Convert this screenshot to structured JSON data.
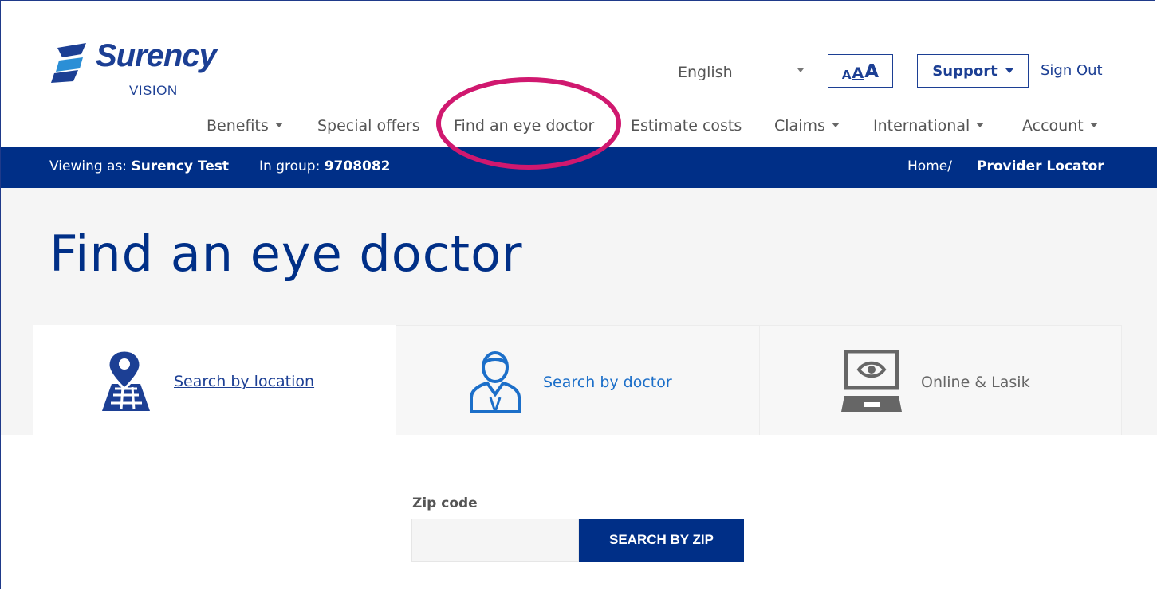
{
  "brand": {
    "name": "Surency",
    "sub": "VISION"
  },
  "header": {
    "language": "English",
    "text_size": {
      "small": "A",
      "medium": "A",
      "large": "A"
    },
    "support_label": "Support",
    "signout_label": "Sign Out"
  },
  "nav": {
    "items": [
      {
        "label": "Benefits",
        "dropdown": true
      },
      {
        "label": "Special offers",
        "dropdown": false
      },
      {
        "label": "Find an eye doctor",
        "dropdown": false
      },
      {
        "label": "Estimate costs",
        "dropdown": false
      },
      {
        "label": "Claims",
        "dropdown": true
      },
      {
        "label": "International",
        "dropdown": true
      },
      {
        "label": "Account",
        "dropdown": true
      }
    ]
  },
  "bar": {
    "viewing_prefix": "Viewing as:",
    "viewing_name": "Surency Test",
    "group_prefix": "In group:",
    "group_id": "9708082",
    "breadcrumb_home": "Home/",
    "breadcrumb_current": "Provider Locator"
  },
  "page": {
    "title": "Find an eye doctor",
    "tabs": [
      {
        "label": "Search by location",
        "icon": "map-pin-icon",
        "active": true
      },
      {
        "label": "Search by doctor",
        "icon": "doctor-icon",
        "active": false
      },
      {
        "label": "Online & Lasik",
        "icon": "laptop-eye-icon",
        "active": false
      }
    ],
    "zip": {
      "label": "Zip code",
      "value": "",
      "button": "SEARCH BY ZIP"
    }
  },
  "colors": {
    "brand_blue": "#002f87",
    "highlight": "#d0186f",
    "link_blue": "#1c6fc9"
  }
}
